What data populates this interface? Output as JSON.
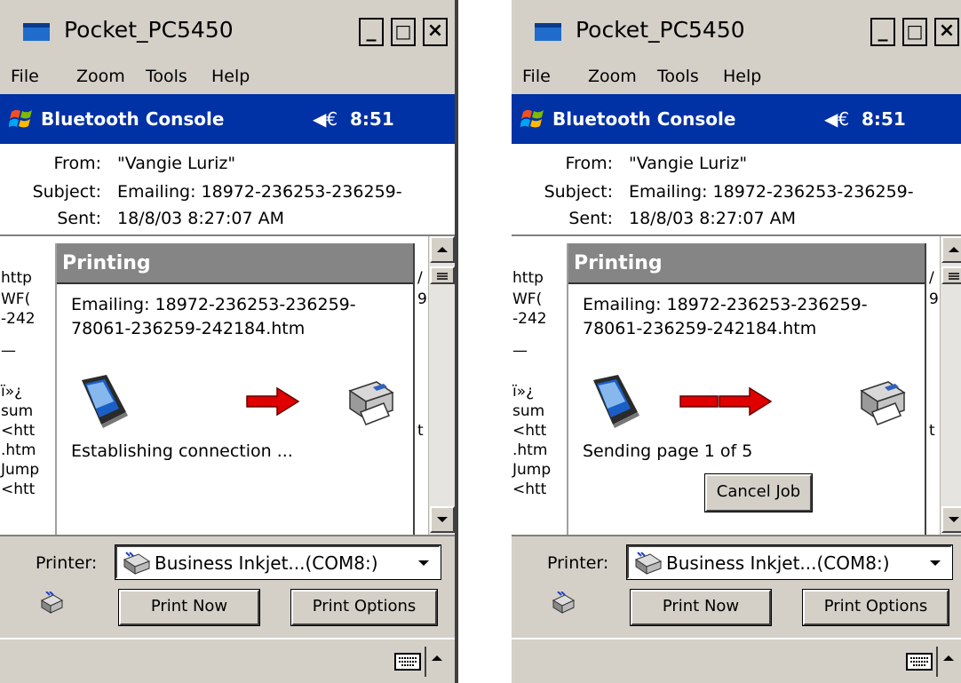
{
  "screens": [
    {
      "window_title": "Pocket_PC5450",
      "window_controls": [
        "_",
        "□",
        "×"
      ],
      "menu": [
        "File",
        "Zoom",
        "Tools",
        "Help"
      ],
      "taskbar": {
        "title": "Bluetooth Console",
        "speaker": "◀€",
        "time": "8:51"
      },
      "header": {
        "from_label": "From:",
        "from_value": "\"Vangie Luriz\"",
        "subject_label": "Subject:",
        "subject_value": "Emailing: 18972-236253-236259-",
        "sent_label": "Sent:",
        "sent_value": "18/8/03 8:27:07 AM"
      },
      "body_fragments": [
        "http",
        "WF(",
        "-242",
        "—",
        "ï»¿",
        "sum",
        "<htt",
        ".htm",
        "Jump",
        "<htt"
      ],
      "body_fragments_right": [
        "/",
        "9",
        "t"
      ],
      "dialog": {
        "title": "Printing",
        "document": "Emailing: 18972-236253-236259-78061-236259-242184.htm",
        "status": "Establishing connection ..."
      },
      "printer_label": "Printer:",
      "printer_value": "Business Inkjet...(COM8:)",
      "print_now": "Print Now",
      "print_options": "Print Options"
    },
    {
      "window_title": "Pocket_PC5450",
      "window_controls": [
        "_",
        "□",
        "×"
      ],
      "menu": [
        "File",
        "Zoom",
        "Tools",
        "Help"
      ],
      "taskbar": {
        "title": "Bluetooth Console",
        "speaker": "◀€",
        "time": "8:51"
      },
      "header": {
        "from_label": "From:",
        "from_value": "\"Vangie Luriz\"",
        "subject_label": "Subject:",
        "subject_value": "Emailing: 18972-236253-236259-",
        "sent_label": "Sent:",
        "sent_value": "18/8/03 8:27:07 AM"
      },
      "body_fragments": [
        "http",
        "WF(",
        "-242",
        "—",
        "ï»¿",
        "sum",
        "<htt",
        ".htm",
        "Jump",
        "<htt"
      ],
      "body_fragments_right": [
        "/",
        "9",
        "t"
      ],
      "dialog": {
        "title": "Printing",
        "document": "Emailing: 18972-236253-236259-78061-236259-242184.htm",
        "status": "Sending page 1 of 5",
        "cancel": "Cancel Job"
      },
      "printer_label": "Printer:",
      "printer_value": "Business Inkjet...(COM8:)",
      "print_now": "Print Now",
      "print_options": "Print Options"
    }
  ],
  "colors": {
    "taskbar": "#0031a5",
    "chrome": "#d4d0c8",
    "dialog_title": "#858585",
    "arrow": "#e00000"
  },
  "icons": [
    "app-window-icon",
    "windows-flag-icon",
    "speaker-icon",
    "pda-icon",
    "arrow-right-icon",
    "printer-icon",
    "keyboard-icon"
  ]
}
